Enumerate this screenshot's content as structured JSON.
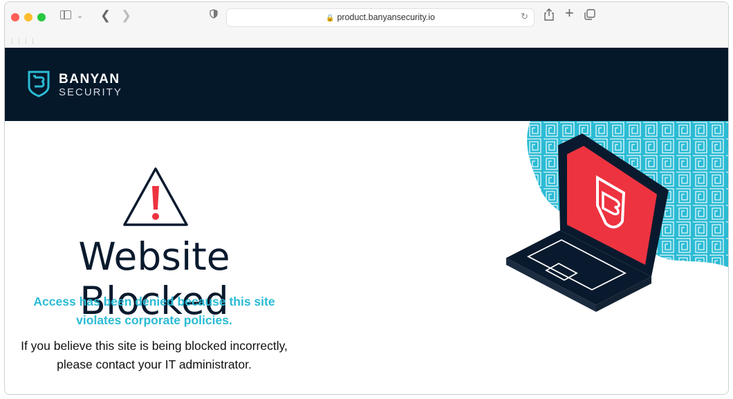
{
  "browser": {
    "url": "product.banyansecurity.io",
    "icons": [
      "sidebar-icon",
      "chevron-down-icon",
      "back-icon",
      "forward-icon",
      "shield-icon",
      "lock-icon",
      "reload-icon",
      "share-icon",
      "new-tab-icon",
      "tabs-icon",
      "grid-icon"
    ]
  },
  "header": {
    "brand_line1": "BANYAN",
    "brand_line2": "SECURITY",
    "background": "#04182a"
  },
  "main": {
    "title": "Website Blocked",
    "lead_line1": "Access has been denied because this site",
    "lead_line2": "violates corporate policies.",
    "help_line1": "If you believe this site is being blocked incorrectly,",
    "help_line2": "please contact your IT administrator.",
    "accent_color": "#2bbbd4",
    "alert_color": "#ee3340"
  }
}
